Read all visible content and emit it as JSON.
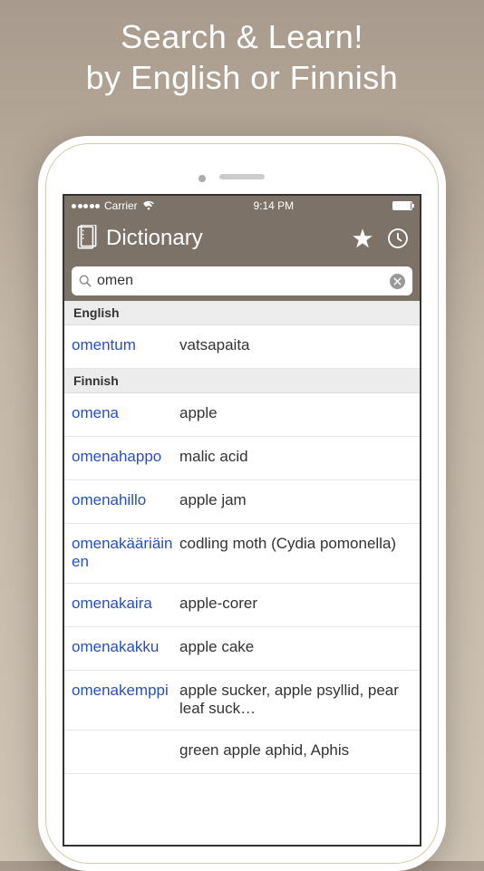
{
  "promo": {
    "line1": "Search & Learn!",
    "line2": "by English or Finnish"
  },
  "status": {
    "carrier": "Carrier",
    "time": "9:14 PM"
  },
  "nav": {
    "title": "Dictionary"
  },
  "search": {
    "value": "omen",
    "placeholder": ""
  },
  "sections": [
    {
      "header": "English",
      "rows": [
        {
          "term": "omentum",
          "def": "vatsapaita"
        }
      ]
    },
    {
      "header": "Finnish",
      "rows": [
        {
          "term": "omena",
          "def": "apple"
        },
        {
          "term": "omenahappo",
          "def": "malic acid"
        },
        {
          "term": "omenahillo",
          "def": "apple jam"
        },
        {
          "term": "omenakääriäinen",
          "def": "codling moth (Cydia pomonella)"
        },
        {
          "term": "omenakaira",
          "def": "apple-corer"
        },
        {
          "term": "omenakakku",
          "def": "apple cake"
        },
        {
          "term": "omenakemppi",
          "def": "apple sucker, apple psyllid, pear leaf suck…"
        },
        {
          "term": "",
          "def": "green apple aphid, Aphis"
        }
      ]
    }
  ]
}
